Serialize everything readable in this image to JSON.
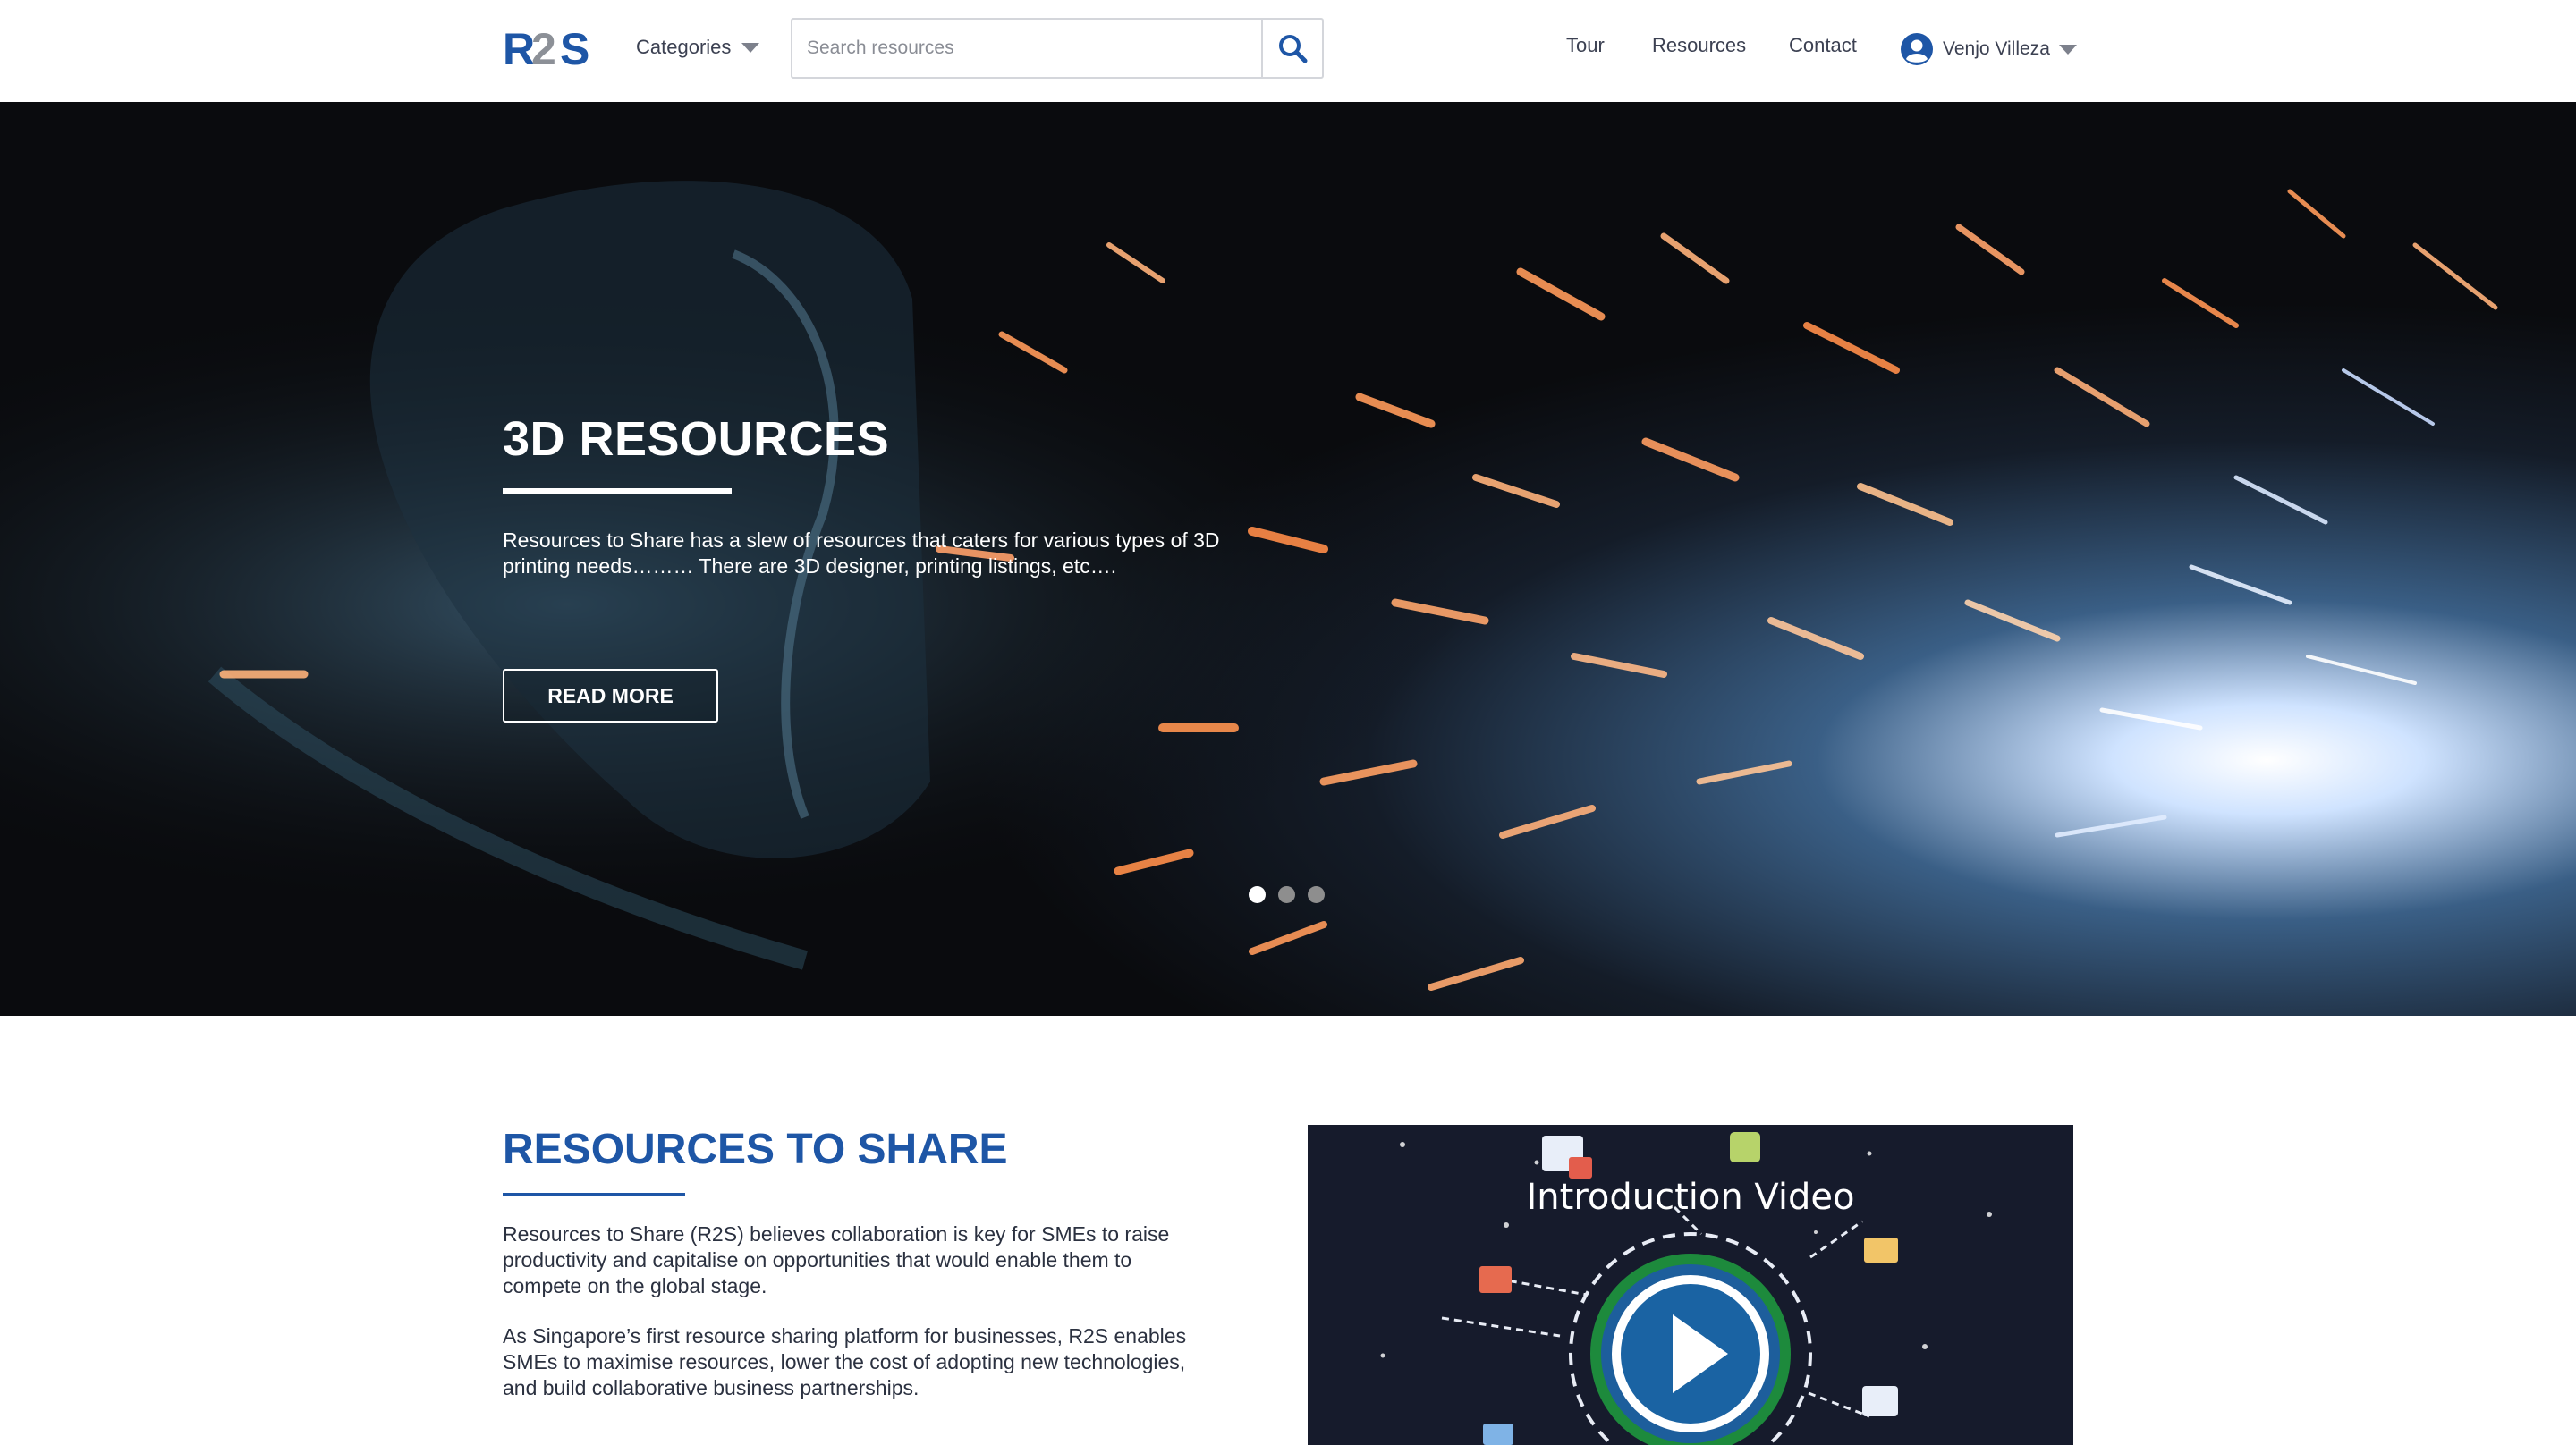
{
  "header": {
    "logo_text": "R2S",
    "categories_label": "Categories",
    "search_placeholder": "Search resources",
    "nav": [
      {
        "label": "Tour"
      },
      {
        "label": "Resources"
      },
      {
        "label": "Contact"
      }
    ],
    "user_name": "Venjo Villeza"
  },
  "hero": {
    "title": "3D RESOURCES",
    "text": "Resources to Share has a slew of resources that caters for various types of 3D printing needs……… There are 3D designer, printing listings, etc….",
    "button_label": "READ MORE",
    "slides_total": 3,
    "slide_active": 1
  },
  "about": {
    "title": "RESOURCES TO SHARE",
    "paragraph1": "Resources to Share (R2S) believes collaboration is key for SMEs to raise productivity and capitalise on opportunities that would enable them to compete on the global stage.",
    "paragraph2": "As Singapore’s first resource sharing platform for businesses, R2S enables SMEs to maximise resources, lower the cost of adopting new technologies, and build collaborative business partnerships."
  },
  "video": {
    "title": "Introduction Video"
  },
  "colors": {
    "brand_blue": "#1e56a6",
    "logo_grey": "#8c9097",
    "video_bg": "#161b2c"
  }
}
